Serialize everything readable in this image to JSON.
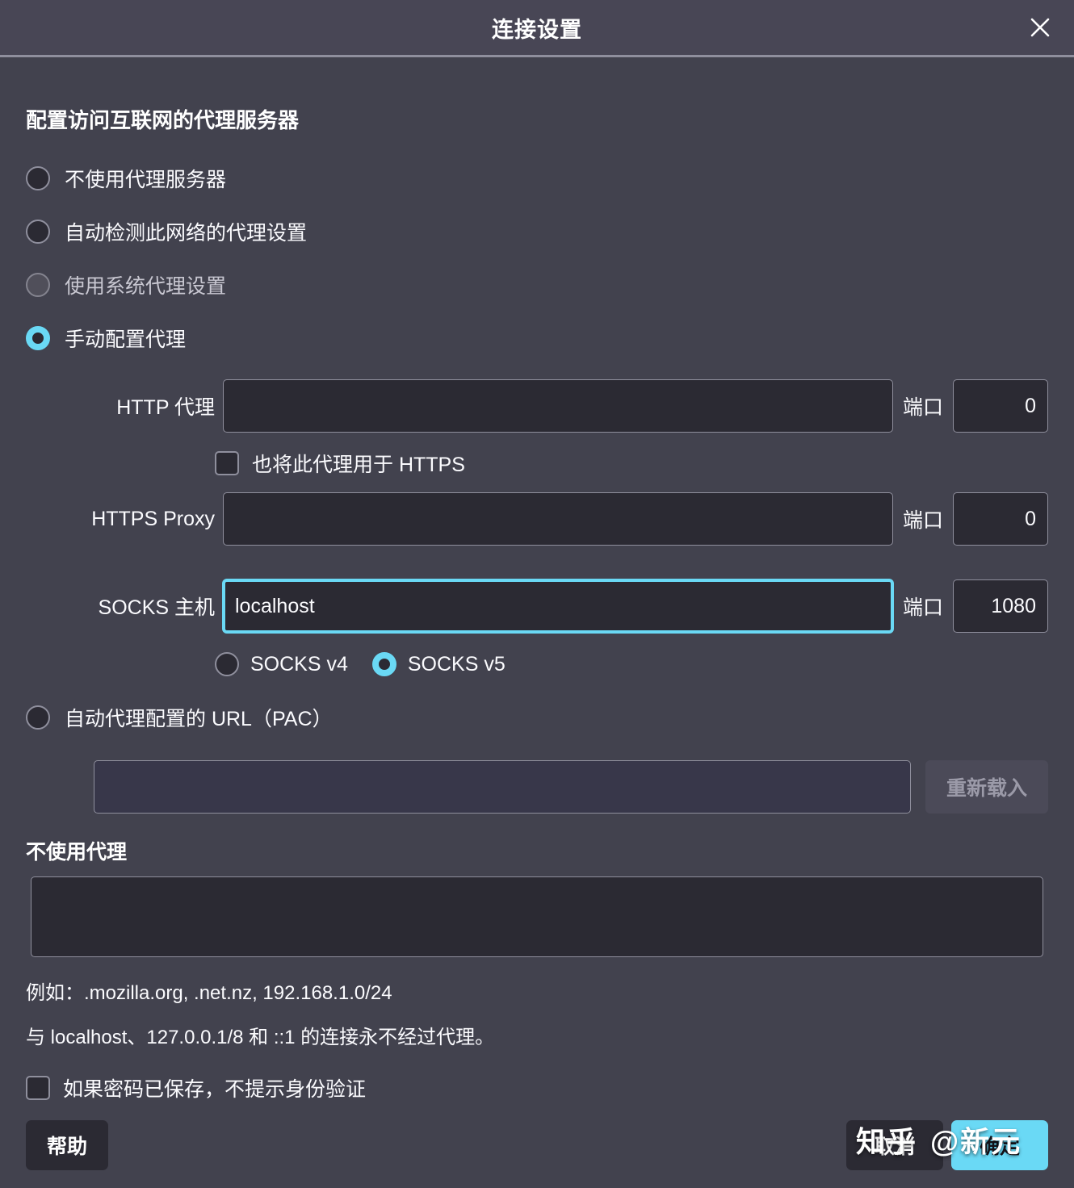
{
  "window": {
    "title": "连接设置",
    "close_icon": "close-icon"
  },
  "section": {
    "heading": "配置访问互联网的代理服务器"
  },
  "proxy_mode_options": [
    {
      "label": "不使用代理服务器",
      "selected": false,
      "disabled": false
    },
    {
      "label": "自动检测此网络的代理设置",
      "selected": false,
      "disabled": false
    },
    {
      "label": "使用系统代理设置",
      "selected": false,
      "disabled": true
    },
    {
      "label": "手动配置代理",
      "selected": true,
      "disabled": false
    }
  ],
  "manual": {
    "http": {
      "label": "HTTP 代理",
      "value": "",
      "port_label": "端口",
      "port_value": "0"
    },
    "https_checkbox": {
      "label": "也将此代理用于 HTTPS",
      "checked": false
    },
    "https": {
      "label": "HTTPS Proxy",
      "value": "",
      "port_label": "端口",
      "port_value": "0"
    },
    "socks": {
      "label": "SOCKS 主机",
      "value": "localhost",
      "port_label": "端口",
      "port_value": "1080",
      "focused": true
    },
    "socks_version": [
      {
        "label": "SOCKS v4",
        "selected": false
      },
      {
        "label": "SOCKS v5",
        "selected": true
      }
    ]
  },
  "pac": {
    "radio_label": "自动代理配置的 URL（PAC）",
    "selected": false,
    "url_value": "",
    "reload_label": "重新载入",
    "reload_disabled": true
  },
  "no_proxy": {
    "title": "不使用代理",
    "value": "",
    "hint_line1": "例如：.mozilla.org, .net.nz, 192.168.1.0/24",
    "hint_line2": "与 localhost、127.0.0.1/8 和 ::1 的连接永不经过代理。"
  },
  "auth_checkbox": {
    "label": "如果密码已保存，不提示身份验证",
    "checked": false
  },
  "footer": {
    "help_label": "帮助",
    "cancel_label": "取消",
    "ok_label": "确定"
  },
  "watermark": {
    "left": "知乎",
    "right": "@新元"
  },
  "colors": {
    "accent": "#6ad9f5",
    "dialog_bg": "#42424e",
    "titlebar_bg": "#484655",
    "field_bg": "#2b2a33",
    "border": "#8f8f9d",
    "text": "#fbfbfe"
  }
}
